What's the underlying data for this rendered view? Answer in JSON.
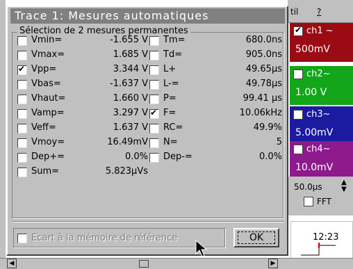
{
  "menu": {
    "util": "til",
    "help": "?"
  },
  "channels": [
    {
      "name": "ch1 ~",
      "value": "500mV",
      "checked": true,
      "color": "#9a0b14"
    },
    {
      "name": "ch2~",
      "value": "1.00 V",
      "checked": false,
      "color": "#13a61b"
    },
    {
      "name": "ch3~",
      "value": "5.00mV",
      "checked": false,
      "color": "#1a1ba0"
    },
    {
      "name": "ch4~",
      "value": "10.0mV",
      "checked": false,
      "color": "#8e1a8e"
    }
  ],
  "timebase": "50.0µs",
  "fft_label": "FFT",
  "clock": "12:23",
  "dialog": {
    "title": "Trace 1: Mesures automatiques",
    "group_title": "Sélection de 2 mesures permanentes",
    "left": [
      {
        "label": "Vmin=",
        "value": "-1.655 V",
        "checked": false
      },
      {
        "label": "Vmax=",
        "value": "1.685 V",
        "checked": false
      },
      {
        "label": "Vpp=",
        "value": "3.344 V",
        "checked": true
      },
      {
        "label": "Vbas=",
        "value": "-1.637 V",
        "checked": false
      },
      {
        "label": "Vhaut=",
        "value": "1.660 V",
        "checked": false
      },
      {
        "label": "Vamp=",
        "value": "3.297 V",
        "checked": false
      },
      {
        "label": "Veff=",
        "value": "1.637 V",
        "checked": false
      },
      {
        "label": "Vmoy=",
        "value": "16.49mV",
        "checked": false
      },
      {
        "label": "Dep+=",
        "value": "0.0%",
        "checked": false
      },
      {
        "label": "Sum=",
        "value": "5.823µVs",
        "checked": false
      }
    ],
    "right": [
      {
        "label": "Tm=",
        "value": "680.0ns",
        "checked": false
      },
      {
        "label": "Td=",
        "value": "905.0ns",
        "checked": false
      },
      {
        "label": "L+",
        "value": "49.65µs",
        "checked": false
      },
      {
        "label": "L-=",
        "value": "49.78µs",
        "checked": false
      },
      {
        "label": "P=",
        "value": "99.41 µs",
        "checked": false
      },
      {
        "label": "F=",
        "value": "10.06kHz",
        "checked": true
      },
      {
        "label": "RC=",
        "value": "49.9%",
        "checked": false
      },
      {
        "label": "N=",
        "value": "5",
        "checked": false
      },
      {
        "label": "Dep-=",
        "value": "0.0%",
        "checked": false
      }
    ],
    "ref_label": "Ecart à la mémoire de référence",
    "ok_label": "OK"
  }
}
